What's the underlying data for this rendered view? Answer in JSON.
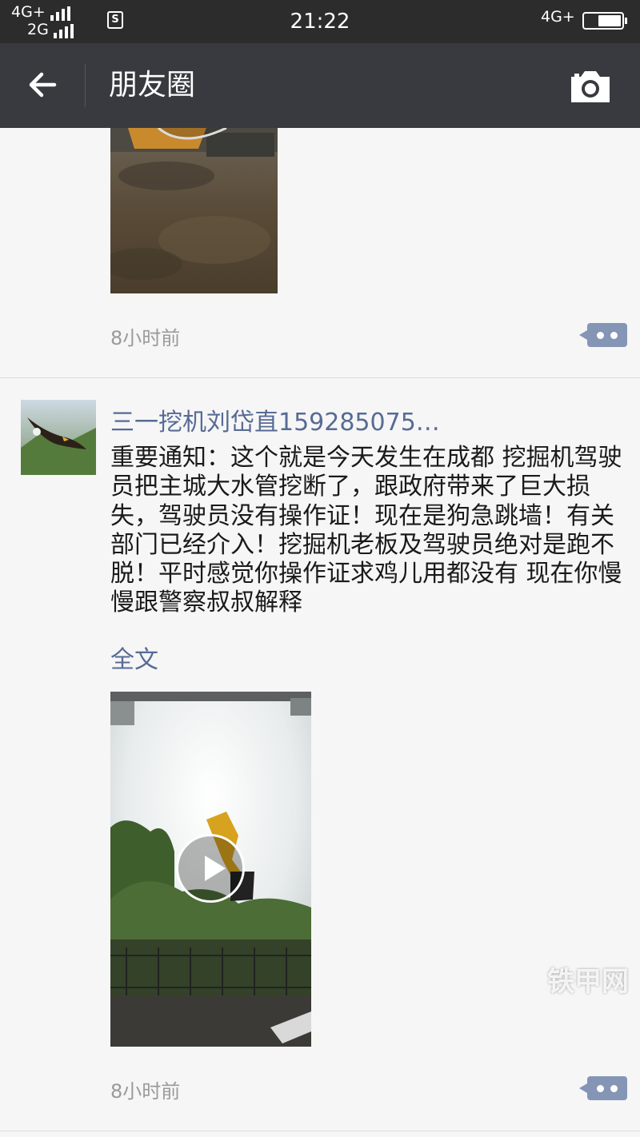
{
  "status_bar": {
    "network_1": "4G+",
    "network_2": "2G",
    "sim_label": "S",
    "time": "21:22",
    "network_right": "4G+"
  },
  "nav": {
    "title": "朋友圈",
    "back_icon": "back-arrow-icon",
    "camera_icon": "camera-icon"
  },
  "posts": [
    {
      "media": "excavator-dirt-video-thumbnail",
      "time": "8小时前"
    },
    {
      "author": "三一挖机刘岱直159285075…",
      "avatar": "eagle-avatar",
      "text": "重要通知：这个就是今天发生在成都 挖掘机驾驶员把主城大水管挖断了，跟政府带来了巨大损失，驾驶员没有操作证！现在是狗急跳墙！有关部门已经介入！挖掘机老板及驾驶员绝对是跑不脱！平时感觉你操作证求鸡儿用都没有 现在你慢慢跟警察叔叔解释",
      "full_text_link": "全文",
      "media": "water-burst-excavator-video-thumbnail",
      "time": "8小时前"
    }
  ],
  "watermark": "铁甲网",
  "colors": {
    "nav_bg": "#393a3f",
    "status_bg": "#2c2c2c",
    "link": "#576b95",
    "feed_bg": "#f6f6f6"
  }
}
